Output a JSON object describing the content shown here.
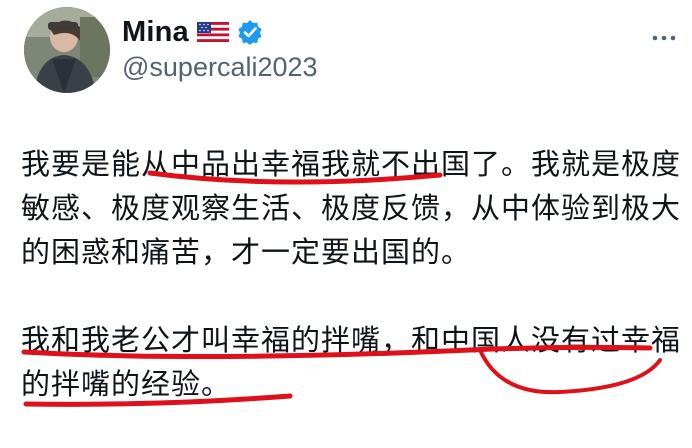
{
  "tweet": {
    "author": {
      "display_name": "Mina",
      "flag_icon": "us-flag-icon",
      "verified_icon": "verified-badge-icon",
      "handle": "@supercali2023"
    },
    "body": {
      "paragraph_1": "我要是能从中品出幸福我就不出国了。我就是极度敏感、极度观察生活、极度反馈，从中体验到极大的困惑和痛苦，才一定要出国的。",
      "paragraph_2": "我和我老公才叫幸福的拌嘴，和中国人没有过幸福的拌嘴的经验。"
    },
    "annotation_color": "#e0101a"
  }
}
